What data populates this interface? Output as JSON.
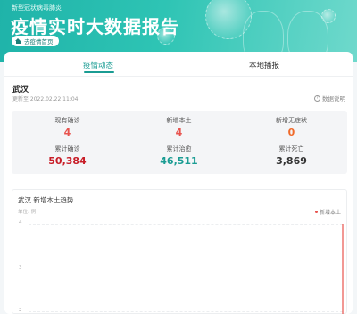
{
  "header": {
    "subtitle": "新型冠状病毒肺炎",
    "title": "疫情实时大数据报告",
    "home_button": "去疫情首页"
  },
  "tabs": [
    {
      "label": "疫情动态",
      "active": true
    },
    {
      "label": "本地播报",
      "active": false
    }
  ],
  "location": {
    "city": "武汉",
    "updated": "更新至 2022.02.22 11:04",
    "explain_label": "数据说明"
  },
  "stats": [
    {
      "label": "现有确诊",
      "value": "4",
      "color": "#e8534e"
    },
    {
      "label": "新增本土",
      "value": "4",
      "color": "#e8534e"
    },
    {
      "label": "新增无症状",
      "value": "0",
      "color": "#f06a2a"
    },
    {
      "label": "累计确诊",
      "value": "50,384",
      "color": "#c81e28"
    },
    {
      "label": "累计治愈",
      "value": "46,511",
      "color": "#1a9c93"
    },
    {
      "label": "累计死亡",
      "value": "3,869",
      "color": "#333333"
    }
  ],
  "chart": {
    "title": "武汉 新增本土趋势",
    "unit": "单位: 例",
    "legend": "新增本土",
    "yticks": [
      "4",
      "3",
      "2"
    ]
  },
  "chart_data": {
    "type": "line",
    "title": "武汉 新增本土趋势",
    "ylabel": "单位: 例",
    "series": [
      {
        "name": "新增本土",
        "color": "#e8534e",
        "last_value": 4
      }
    ],
    "yticks": [
      2,
      3,
      4
    ],
    "ylim": [
      2,
      4
    ],
    "grid": true,
    "legend_position": "top-right"
  }
}
